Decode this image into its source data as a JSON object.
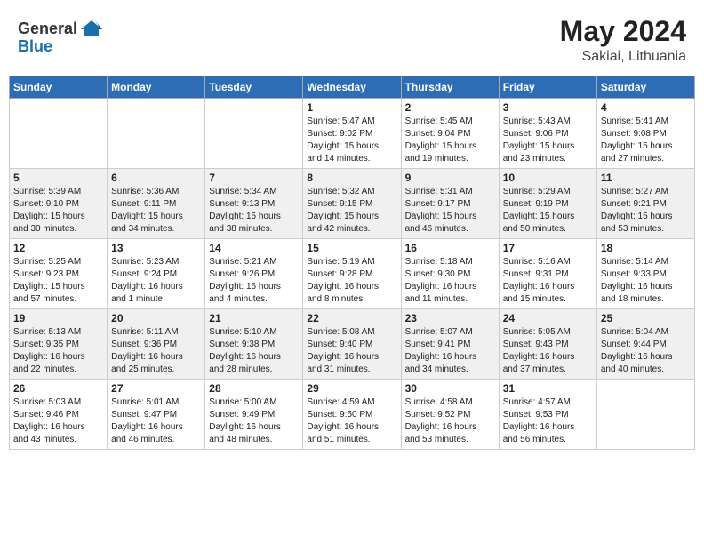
{
  "header": {
    "logo_general": "General",
    "logo_blue": "Blue",
    "month_year": "May 2024",
    "location": "Sakiai, Lithuania"
  },
  "calendar": {
    "days_of_week": [
      "Sunday",
      "Monday",
      "Tuesday",
      "Wednesday",
      "Thursday",
      "Friday",
      "Saturday"
    ],
    "weeks": [
      [
        {
          "day": "",
          "detail": ""
        },
        {
          "day": "",
          "detail": ""
        },
        {
          "day": "",
          "detail": ""
        },
        {
          "day": "1",
          "detail": "Sunrise: 5:47 AM\nSunset: 9:02 PM\nDaylight: 15 hours\nand 14 minutes."
        },
        {
          "day": "2",
          "detail": "Sunrise: 5:45 AM\nSunset: 9:04 PM\nDaylight: 15 hours\nand 19 minutes."
        },
        {
          "day": "3",
          "detail": "Sunrise: 5:43 AM\nSunset: 9:06 PM\nDaylight: 15 hours\nand 23 minutes."
        },
        {
          "day": "4",
          "detail": "Sunrise: 5:41 AM\nSunset: 9:08 PM\nDaylight: 15 hours\nand 27 minutes."
        }
      ],
      [
        {
          "day": "5",
          "detail": "Sunrise: 5:39 AM\nSunset: 9:10 PM\nDaylight: 15 hours\nand 30 minutes."
        },
        {
          "day": "6",
          "detail": "Sunrise: 5:36 AM\nSunset: 9:11 PM\nDaylight: 15 hours\nand 34 minutes."
        },
        {
          "day": "7",
          "detail": "Sunrise: 5:34 AM\nSunset: 9:13 PM\nDaylight: 15 hours\nand 38 minutes."
        },
        {
          "day": "8",
          "detail": "Sunrise: 5:32 AM\nSunset: 9:15 PM\nDaylight: 15 hours\nand 42 minutes."
        },
        {
          "day": "9",
          "detail": "Sunrise: 5:31 AM\nSunset: 9:17 PM\nDaylight: 15 hours\nand 46 minutes."
        },
        {
          "day": "10",
          "detail": "Sunrise: 5:29 AM\nSunset: 9:19 PM\nDaylight: 15 hours\nand 50 minutes."
        },
        {
          "day": "11",
          "detail": "Sunrise: 5:27 AM\nSunset: 9:21 PM\nDaylight: 15 hours\nand 53 minutes."
        }
      ],
      [
        {
          "day": "12",
          "detail": "Sunrise: 5:25 AM\nSunset: 9:23 PM\nDaylight: 15 hours\nand 57 minutes."
        },
        {
          "day": "13",
          "detail": "Sunrise: 5:23 AM\nSunset: 9:24 PM\nDaylight: 16 hours\nand 1 minute."
        },
        {
          "day": "14",
          "detail": "Sunrise: 5:21 AM\nSunset: 9:26 PM\nDaylight: 16 hours\nand 4 minutes."
        },
        {
          "day": "15",
          "detail": "Sunrise: 5:19 AM\nSunset: 9:28 PM\nDaylight: 16 hours\nand 8 minutes."
        },
        {
          "day": "16",
          "detail": "Sunrise: 5:18 AM\nSunset: 9:30 PM\nDaylight: 16 hours\nand 11 minutes."
        },
        {
          "day": "17",
          "detail": "Sunrise: 5:16 AM\nSunset: 9:31 PM\nDaylight: 16 hours\nand 15 minutes."
        },
        {
          "day": "18",
          "detail": "Sunrise: 5:14 AM\nSunset: 9:33 PM\nDaylight: 16 hours\nand 18 minutes."
        }
      ],
      [
        {
          "day": "19",
          "detail": "Sunrise: 5:13 AM\nSunset: 9:35 PM\nDaylight: 16 hours\nand 22 minutes."
        },
        {
          "day": "20",
          "detail": "Sunrise: 5:11 AM\nSunset: 9:36 PM\nDaylight: 16 hours\nand 25 minutes."
        },
        {
          "day": "21",
          "detail": "Sunrise: 5:10 AM\nSunset: 9:38 PM\nDaylight: 16 hours\nand 28 minutes."
        },
        {
          "day": "22",
          "detail": "Sunrise: 5:08 AM\nSunset: 9:40 PM\nDaylight: 16 hours\nand 31 minutes."
        },
        {
          "day": "23",
          "detail": "Sunrise: 5:07 AM\nSunset: 9:41 PM\nDaylight: 16 hours\nand 34 minutes."
        },
        {
          "day": "24",
          "detail": "Sunrise: 5:05 AM\nSunset: 9:43 PM\nDaylight: 16 hours\nand 37 minutes."
        },
        {
          "day": "25",
          "detail": "Sunrise: 5:04 AM\nSunset: 9:44 PM\nDaylight: 16 hours\nand 40 minutes."
        }
      ],
      [
        {
          "day": "26",
          "detail": "Sunrise: 5:03 AM\nSunset: 9:46 PM\nDaylight: 16 hours\nand 43 minutes."
        },
        {
          "day": "27",
          "detail": "Sunrise: 5:01 AM\nSunset: 9:47 PM\nDaylight: 16 hours\nand 46 minutes."
        },
        {
          "day": "28",
          "detail": "Sunrise: 5:00 AM\nSunset: 9:49 PM\nDaylight: 16 hours\nand 48 minutes."
        },
        {
          "day": "29",
          "detail": "Sunrise: 4:59 AM\nSunset: 9:50 PM\nDaylight: 16 hours\nand 51 minutes."
        },
        {
          "day": "30",
          "detail": "Sunrise: 4:58 AM\nSunset: 9:52 PM\nDaylight: 16 hours\nand 53 minutes."
        },
        {
          "day": "31",
          "detail": "Sunrise: 4:57 AM\nSunset: 9:53 PM\nDaylight: 16 hours\nand 56 minutes."
        },
        {
          "day": "",
          "detail": ""
        }
      ]
    ]
  }
}
